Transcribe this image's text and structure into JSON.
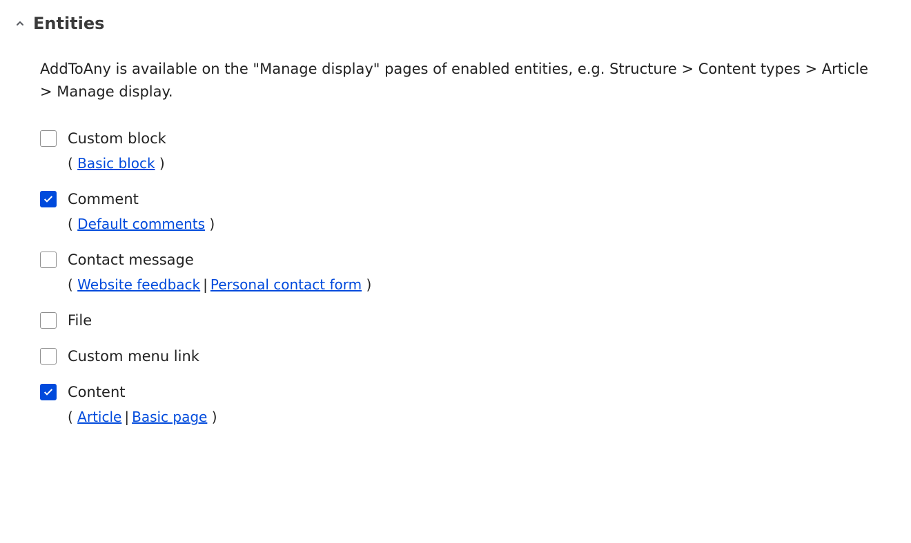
{
  "section": {
    "title": "Entities",
    "description": "AddToAny is available on the \"Manage display\" pages of enabled entities, e.g. Structure > Content types > Article > Manage display."
  },
  "entities": [
    {
      "label": "Custom block",
      "checked": false,
      "links": [
        "Basic block"
      ]
    },
    {
      "label": "Comment",
      "checked": true,
      "links": [
        "Default comments"
      ]
    },
    {
      "label": "Contact message",
      "checked": false,
      "links": [
        "Website feedback",
        "Personal contact form"
      ]
    },
    {
      "label": "File",
      "checked": false,
      "links": []
    },
    {
      "label": "Custom menu link",
      "checked": false,
      "links": []
    },
    {
      "label": "Content",
      "checked": true,
      "links": [
        "Article",
        "Basic page"
      ]
    }
  ]
}
